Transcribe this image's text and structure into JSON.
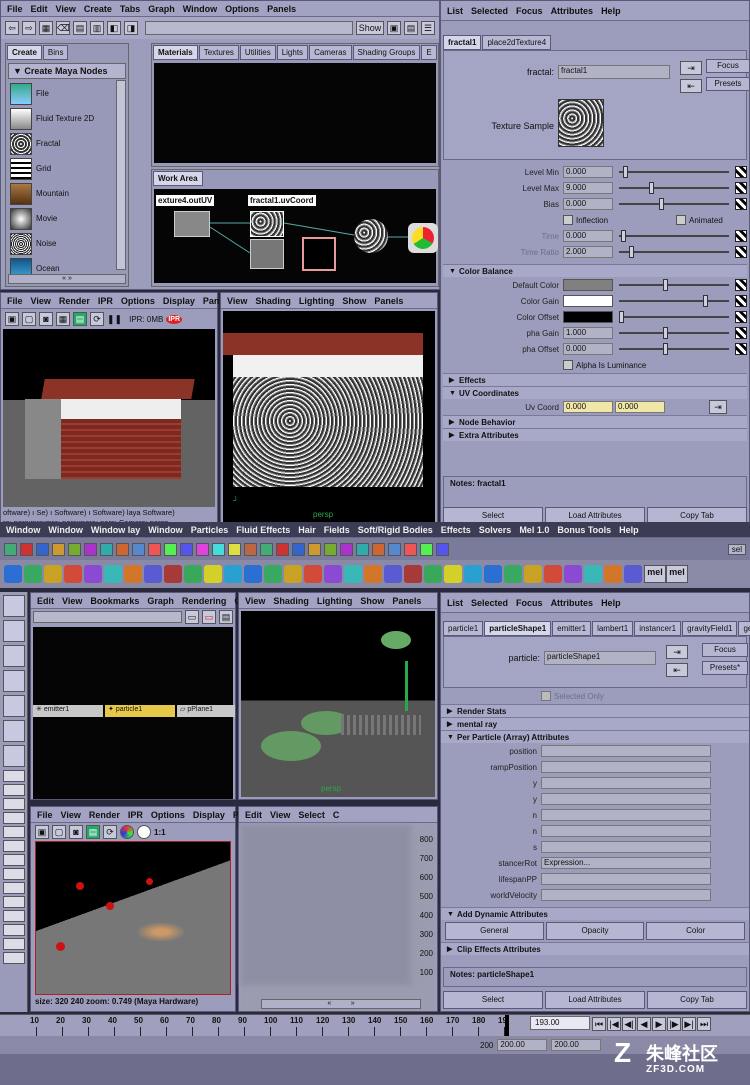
{
  "top_left_menu": [
    "File",
    "Edit",
    "View",
    "Create",
    "Tabs",
    "Graph",
    "Window",
    "Options",
    "Panels"
  ],
  "hypershade": {
    "show_label": "Show",
    "create_tabs": [
      "Create",
      "Bins"
    ],
    "create_header": "Create Maya Nodes",
    "nodes": [
      "File",
      "Fluid Texture 2D",
      "Fractal",
      "Grid",
      "Mountain",
      "Movie",
      "Noise",
      "Ocean"
    ],
    "material_tabs": [
      "Materials",
      "Textures",
      "Utilities",
      "Lights",
      "Cameras",
      "Shading Groups",
      "E"
    ],
    "work_area_label": "Work Area",
    "conn_left": "exture4.outUV",
    "conn_right": "fractal1.uvCoord"
  },
  "attr_editor_top": {
    "menu": [
      "List",
      "Selected",
      "Focus",
      "Attributes",
      "Help"
    ],
    "tabs": [
      "fractal1",
      "place2dTexture4"
    ],
    "node_label": "fractal:",
    "node_value": "fractal1",
    "focus": "Focus",
    "presets": "Presets",
    "texture_sample": "Texture Sample",
    "rows": [
      {
        "label": "Level Min",
        "value": "0.000"
      },
      {
        "label": "Level Max",
        "value": "9.000"
      },
      {
        "label": "Bias",
        "value": "0.000"
      }
    ],
    "inflection": "Inflection",
    "animated": "Animated",
    "time": {
      "label": "Time",
      "value": "0.000"
    },
    "time_ratio": {
      "label": "Time Ratio",
      "value": "2.000"
    },
    "color_balance": "Color Balance",
    "cb_rows": [
      "Default Color",
      "Color Gain",
      "Color Offset"
    ],
    "alpha_gain": {
      "label": "pha Gain",
      "value": "1.000"
    },
    "alpha_offset": {
      "label": "pha Offset",
      "value": "0.000"
    },
    "alpha_lum": "Alpha Is Luminance",
    "effects": "Effects",
    "uv_coords": "UV Coordinates",
    "uv_coord_label": "Uv Coord",
    "uv_coord_values": [
      "0.000",
      "0.000"
    ],
    "node_behavior": "Node Behavior",
    "extra_attributes": "Extra Attributes",
    "notes": "Notes: fractal1",
    "buttons": [
      "Select",
      "Load Attributes",
      "Copy Tab"
    ]
  },
  "render_view_top": {
    "menu": [
      "File",
      "View",
      "Render",
      "IPR",
      "Options",
      "Display",
      "Panel"
    ],
    "ipr_label": "IPR: 0MB",
    "ipr_badge": "IPR",
    "status_line1": "oftware) ı Se) ı Software) ı Software) laya Software)",
    "status_line2": "ra: persımrsımra: persımera: persı Camera: persp"
  },
  "viewport_top": {
    "menu": [
      "View",
      "Shading",
      "Lighting",
      "Show",
      "Panels"
    ],
    "label": "persp"
  },
  "main_menu": [
    "Window",
    "Particles",
    "Fluid Effects",
    "Hair",
    "Fields",
    "Soft/Rigid Bodies",
    "Effects",
    "Solvers",
    "Mel 1.0",
    "Bonus Tools",
    "Help"
  ],
  "main_menu_left": [
    "Window",
    "Window",
    "Window lay"
  ],
  "sel_label": "sel",
  "shelf_mel": [
    "mel",
    "mel"
  ],
  "hypergraph": {
    "menu": [
      "Edit",
      "View",
      "Bookmarks",
      "Graph",
      "Rendering",
      "Op"
    ],
    "nodes": [
      "emitter1",
      "particle1",
      "pPlane1"
    ]
  },
  "viewport_bottom": {
    "menu": [
      "View",
      "Shading",
      "Lighting",
      "Show",
      "Panels"
    ],
    "label": "persp"
  },
  "attr_editor_bottom": {
    "menu": [
      "List",
      "Selected",
      "Focus",
      "Attributes",
      "Help"
    ],
    "tabs": [
      "particle1",
      "particleShape1",
      "emitter1",
      "lambert1",
      "instancer1",
      "gravityField1",
      "ge"
    ],
    "node_label": "particle:",
    "node_value": "particleShape1",
    "focus": "Focus",
    "presets": "Presets*",
    "selected_only": "Selected Only",
    "sections": [
      "Render Stats",
      "mental ray",
      "Per Particle (Array) Attributes"
    ],
    "attrs": [
      "position",
      "rampPosition",
      "y",
      "y",
      "n",
      "n",
      "s",
      "stancerRot",
      "lifespanPP",
      "worldVelocity"
    ],
    "instancer_value": "Expression...",
    "add_dynamic": "Add Dynamic Attributes",
    "dyn_buttons": [
      "General",
      "Opacity",
      "Color"
    ],
    "clip_effects": "Clip Effects Attributes",
    "notes": "Notes: particleShape1",
    "buttons": [
      "Select",
      "Load Attributes",
      "Copy Tab"
    ]
  },
  "render_view_bottom": {
    "menu": [
      "File",
      "View",
      "Render",
      "IPR",
      "Options",
      "Display",
      "Par"
    ],
    "zoom_label": "1:1",
    "status": "size: 320 240 zoom: 0.749 (Maya Hardware)"
  },
  "graph_editor": {
    "menu": [
      "Edit",
      "View",
      "Select",
      "C"
    ],
    "y_ticks": [
      "800",
      "700",
      "600",
      "500",
      "400",
      "300",
      "200",
      "100"
    ]
  },
  "timeline": {
    "ticks": [
      "10",
      "20",
      "30",
      "40",
      "50",
      "60",
      "70",
      "80",
      "90",
      "100",
      "110",
      "120",
      "130",
      "140",
      "150",
      "160",
      "170",
      "180",
      "19"
    ],
    "current_frame": "193.00",
    "range_start": "200",
    "range_end_a": "200.00",
    "range_end_b": "200.00"
  },
  "watermark": {
    "text": "朱峰社区",
    "sub": "ZF3D.COM"
  },
  "colors": {
    "highlight": "#f0e6a8",
    "selected_node": "#e7c94a",
    "viewport_green": "#2aa84a"
  }
}
